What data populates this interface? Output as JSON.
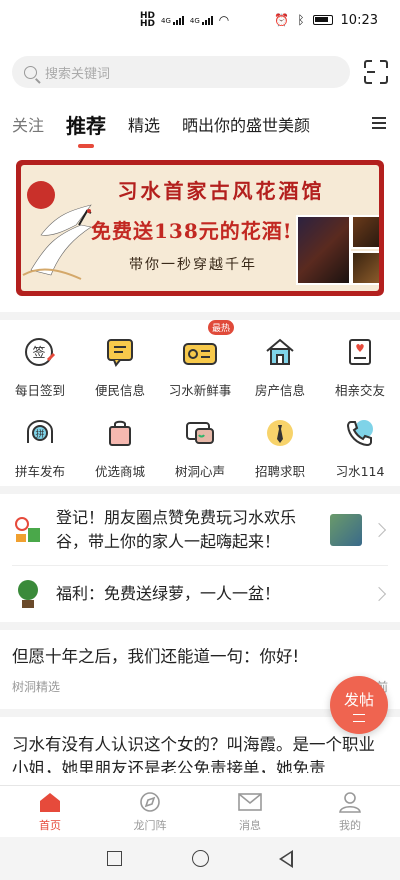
{
  "status_bar": {
    "time": "10:23",
    "network_1": "4G",
    "network_2": "4G"
  },
  "search": {
    "placeholder": "搜索关键词"
  },
  "tabs": [
    {
      "label": "关注"
    },
    {
      "label": "推荐"
    },
    {
      "label": "精选"
    },
    {
      "label": "晒出你的盛世美颜"
    }
  ],
  "banner": {
    "title": "习水首家古风花酒馆",
    "subtitle": "免费送138元的花酒!",
    "tagline": "带你一秒穿越千年"
  },
  "grid": [
    {
      "label": "每日签到",
      "icon": "checkin-icon"
    },
    {
      "label": "便民信息",
      "icon": "message-icon"
    },
    {
      "label": "习水新鲜事",
      "icon": "radio-icon",
      "badge": "最热"
    },
    {
      "label": "房产信息",
      "icon": "house-icon"
    },
    {
      "label": "相亲交友",
      "icon": "heart-letter-icon"
    },
    {
      "label": "拼车发布",
      "icon": "car-icon"
    },
    {
      "label": "优选商城",
      "icon": "shopping-bag-icon"
    },
    {
      "label": "树洞心声",
      "icon": "chat-bubble-icon"
    },
    {
      "label": "招聘求职",
      "icon": "tie-icon"
    },
    {
      "label": "习水114",
      "icon": "phone-icon"
    }
  ],
  "news": [
    {
      "text": "登记！朋友圈点赞免费玩习水欢乐谷，带上你的家人一起嗨起来！"
    },
    {
      "text": "福利：免费送绿萝，一人一盆！"
    }
  ],
  "posts": [
    {
      "title": "但愿十年之后，我们还能道一句：你好!",
      "source": "树洞精选",
      "time": "钟前"
    },
    {
      "title": "习水有没有人认识这个女的？叫海霞。是一个职业小姐，她里朋友还是老公免责接单，她免责"
    }
  ],
  "fab": {
    "label": "发帖"
  },
  "bottom_nav": [
    {
      "label": "首页",
      "icon": "home-icon"
    },
    {
      "label": "龙门阵",
      "icon": "compass-icon"
    },
    {
      "label": "消息",
      "icon": "mail-icon"
    },
    {
      "label": "我的",
      "icon": "user-icon"
    }
  ],
  "colors": {
    "accent": "#e64a3b",
    "banner_red": "#b3201e",
    "fab": "#ef6450"
  }
}
